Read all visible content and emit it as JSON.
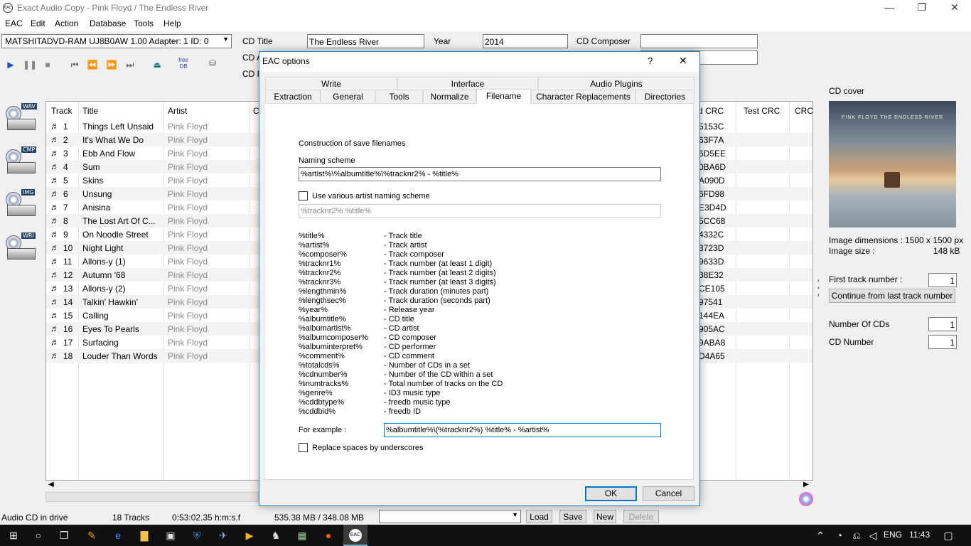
{
  "window": {
    "title": "Exact Audio Copy   -   Pink Floyd / The Endless River",
    "icon_text": "EAC"
  },
  "menu": [
    "EAC",
    "Edit",
    "Action",
    "Database",
    "Tools",
    "Help"
  ],
  "drive": {
    "selected": "MATSHITADVD-RAM UJ8B0AW 1.00   Adapter: 1  ID: 0"
  },
  "cd_fields": {
    "title_label": "CD Title",
    "title": "The Endless River",
    "year_label": "Year",
    "year": "2014",
    "composer_label": "CD Composer",
    "composer": "",
    "artist_label_partial": "CD A",
    "perf_label_partial": "CD P"
  },
  "toolbar": {
    "freedb": "free DB"
  },
  "side_icons": [
    "WAV",
    "CMP",
    "IMG",
    "WRI"
  ],
  "tracklist": {
    "headers": [
      "Track",
      "Title",
      "Artist",
      "C",
      "d CRC",
      "Test CRC",
      "CRC"
    ],
    "rows": [
      [
        "1",
        "Things Left Unsaid",
        "Pink Floyd",
        "5153C"
      ],
      [
        "2",
        "It's What We Do",
        "Pink Floyd",
        "63F7A"
      ],
      [
        "3",
        "Ebb And Flow",
        "Pink Floyd",
        "6D5EE"
      ],
      [
        "4",
        "Sum",
        "Pink Floyd",
        "0BA6D"
      ],
      [
        "5",
        "Skins",
        "Pink Floyd",
        "A090D"
      ],
      [
        "6",
        "Unsung",
        "Pink Floyd",
        "6FD98"
      ],
      [
        "7",
        "Anisina",
        "Pink Floyd",
        "E3D4D"
      ],
      [
        "8",
        "The Lost Art Of C...",
        "Pink Floyd",
        "5CC68"
      ],
      [
        "9",
        "On Noodle Street",
        "Pink Floyd",
        "4332C"
      ],
      [
        "10",
        "Night Light",
        "Pink Floyd",
        "3723D"
      ],
      [
        "11",
        "Allons-y (1)",
        "Pink Floyd",
        "9633D"
      ],
      [
        "12",
        "Autumn '68",
        "Pink Floyd",
        "38E32"
      ],
      [
        "13",
        "Allons-y (2)",
        "Pink Floyd",
        "CE105"
      ],
      [
        "14",
        "Talkin' Hawkin'",
        "Pink Floyd",
        "97541"
      ],
      [
        "15",
        "Calling",
        "Pink Floyd",
        "144EA"
      ],
      [
        "16",
        "Eyes To Pearls",
        "Pink Floyd",
        "905AC"
      ],
      [
        "17",
        "Surfacing",
        "Pink Floyd",
        "9ABA8"
      ],
      [
        "18",
        "Louder Than Words",
        "Pink Floyd",
        "D4A65"
      ]
    ]
  },
  "right_panel": {
    "cover_label": "CD cover",
    "cover_text": "PINK FLOYD THE ENDLESS RIVER",
    "dims_label": "Image dimensions :",
    "dims": "1500 x 1500 px",
    "size_label": "Image size :",
    "size": "148 kB",
    "first_track_label": "First track number :",
    "first_track": "1",
    "continue_btn": "Continue from last track number",
    "num_cds_label": "Number Of CDs",
    "num_cds": "1",
    "cd_number_label": "CD Number",
    "cd_number": "1"
  },
  "status": {
    "drive": "Audio CD in drive",
    "tracks": "18 Tracks",
    "length": "0:53:02.35 h:m:s.f",
    "size": "535.38 MB / 348.08 MB",
    "load": "Load",
    "save": "Save",
    "new": "New",
    "delete": "Delete"
  },
  "dialog": {
    "title": "EAC options",
    "help": "?",
    "close": "✕",
    "tabs_top": [
      "Write",
      "Interface",
      "Audio Plugins"
    ],
    "tabs_bottom": [
      "Extraction",
      "General",
      "Tools",
      "Normalize",
      "Filename",
      "Character Replacements",
      "Directories"
    ],
    "heading": "Construction of save filenames",
    "naming_label": "Naming scheme",
    "naming_value": "%artist%\\%albumtitle%\\%tracknr2% - %title%",
    "various_label": "Use various artist naming scheme",
    "various_value": "%tracknr2% %title%",
    "placeholders": [
      [
        "%title%",
        "- Track title"
      ],
      [
        "%artist%",
        "- Track artist"
      ],
      [
        "%composer%",
        "- Track composer"
      ],
      [
        "%tracknr1%",
        "- Track number (at least 1 digit)"
      ],
      [
        "%tracknr2%",
        "- Track number (at least 2 digits)"
      ],
      [
        "%tracknr3%",
        "- Track number (at least 3 digits)"
      ],
      [
        "%lengthmin%",
        "- Track duration (minutes part)"
      ],
      [
        "%lengthsec%",
        "- Track duration (seconds part)"
      ],
      [
        "%year%",
        "- Release year"
      ],
      [
        "%albumtitle%",
        "- CD title"
      ],
      [
        "%albumartist%",
        "- CD artist"
      ],
      [
        "%albumcomposer%",
        "- CD composer"
      ],
      [
        "%albuminterpret%",
        "- CD performer"
      ],
      [
        "%comment%",
        "- CD comment"
      ],
      [
        "%totalcds%",
        "- Number of CDs in a set"
      ],
      [
        "%cdnumber%",
        "- Number of the CD within a set"
      ],
      [
        "%numtracks%",
        "- Total number of tracks on the CD"
      ],
      [
        "%genre%",
        "- ID3 music type"
      ],
      [
        "%cddbtype%",
        "- freedb music type"
      ],
      [
        "%cddbid%",
        "- freedb ID"
      ]
    ],
    "example_label": "For example :",
    "example_value": "%albumtitle%\\(%tracknr2%) %title% - %artist%",
    "underscore_label": "Replace spaces by underscores",
    "ok": "OK",
    "cancel": "Cancel"
  },
  "taskbar": {
    "lang": "ENG",
    "time": "11:43"
  }
}
